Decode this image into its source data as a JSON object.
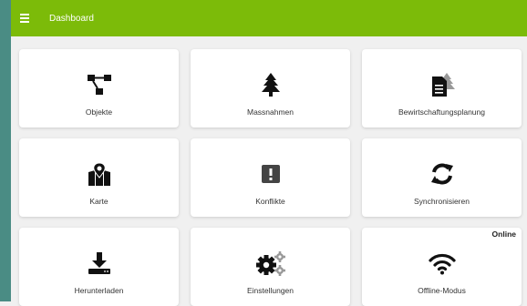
{
  "header": {
    "title": "Dashboard"
  },
  "tiles": [
    {
      "label": "Objekte",
      "icon": "sitemap-icon"
    },
    {
      "label": "Massnahmen",
      "icon": "tree-icon"
    },
    {
      "label": "Bewirtschaftungsplanung",
      "icon": "document-tree-icon"
    },
    {
      "label": "Karte",
      "icon": "map-icon"
    },
    {
      "label": "Konflikte",
      "icon": "warning-icon"
    },
    {
      "label": "Synchronisieren",
      "icon": "sync-icon"
    },
    {
      "label": "Herunterladen",
      "icon": "download-icon"
    },
    {
      "label": "Einstellungen",
      "icon": "gears-icon"
    },
    {
      "label": "Offline-Modus",
      "icon": "wifi-icon",
      "badge": "Online"
    }
  ],
  "colors": {
    "header": "#7cbb09",
    "strip": "#4a8c84",
    "background": "#f0f0f0",
    "icon": "#111111"
  }
}
